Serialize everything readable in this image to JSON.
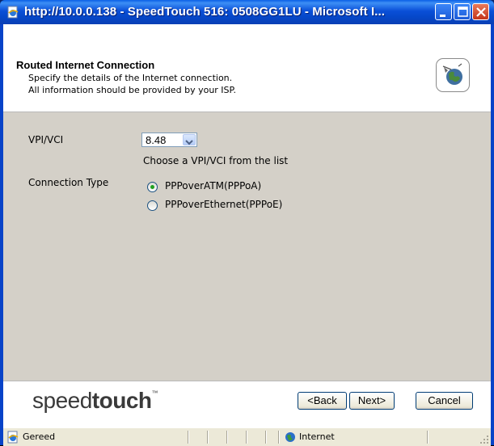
{
  "window": {
    "title": "http://10.0.0.138 - SpeedTouch 516:  0508GG1LU - Microsoft I...",
    "minimize_label": "",
    "maximize_label": "",
    "close_label": ""
  },
  "header": {
    "title": "Routed Internet Connection",
    "subtitle_1": "Specify the details of the Internet connection.",
    "subtitle_2": "All information should be provided by your ISP.",
    "icon": "globe-connection-icon"
  },
  "form": {
    "vpivci_label": "VPI/VCI",
    "vpivci_value": "8.48",
    "vpivci_hint": "Choose a VPI/VCI from the list",
    "connection_type_label": "Connection Type",
    "options": [
      {
        "label": "PPPoverATM(PPPoA)",
        "checked": true
      },
      {
        "label": "PPPoverEthernet(PPPoE)",
        "checked": false
      }
    ]
  },
  "footer": {
    "logo_light": "speed",
    "logo_bold": "touch",
    "logo_tm": "™",
    "back_label": "<Back",
    "next_label": "Next>",
    "cancel_label": "Cancel"
  },
  "statusbar": {
    "status_text": "Gereed",
    "zone_text": "Internet"
  },
  "colors": {
    "titlebar": "#0a4fd8",
    "content_bg": "#d4d0c8",
    "radio_dot": "#21a121"
  }
}
